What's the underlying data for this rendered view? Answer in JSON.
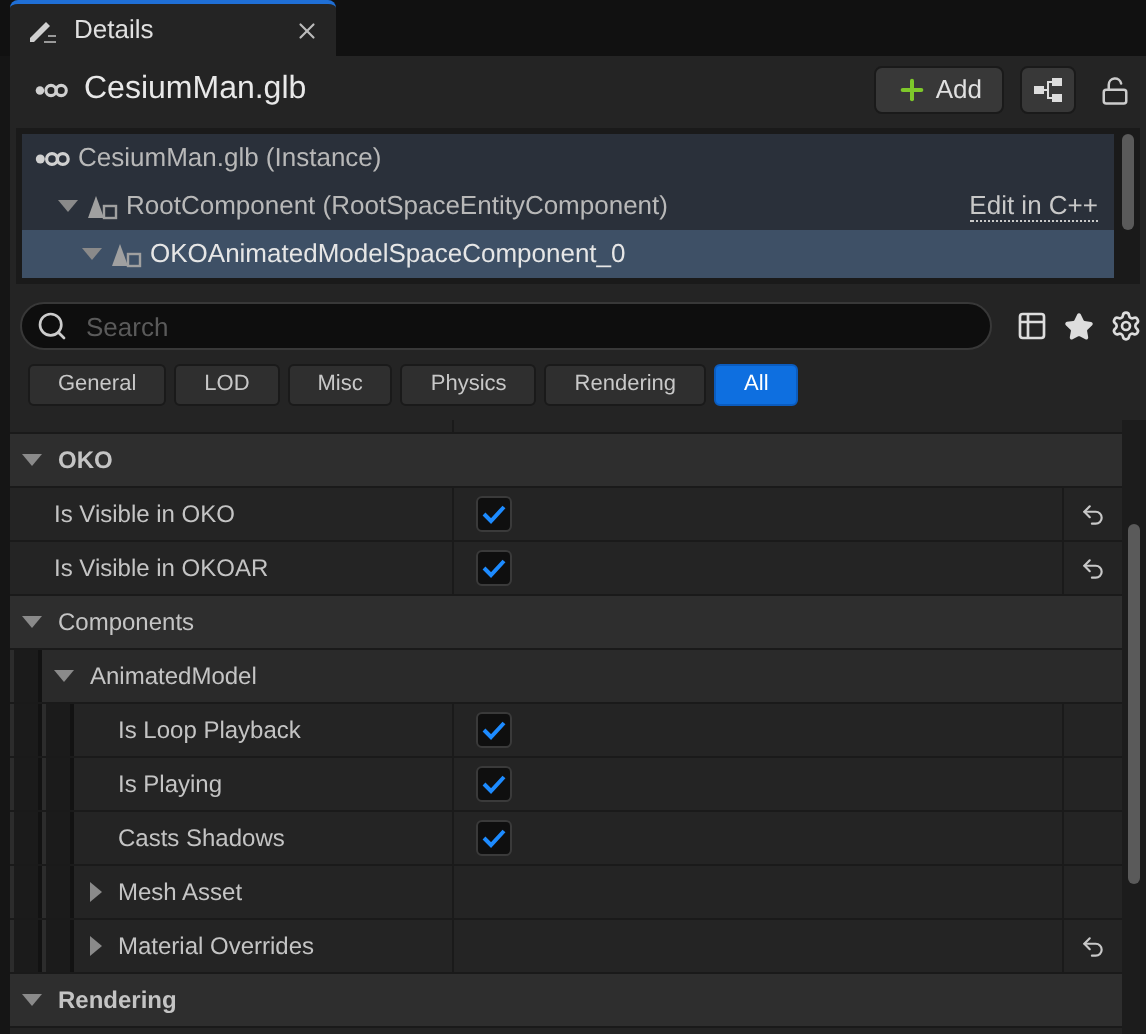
{
  "tab": {
    "title": "Details"
  },
  "header": {
    "title": "CesiumMan.glb",
    "add_button": "Add"
  },
  "tree": {
    "items": [
      {
        "label": "CesiumMan.glb (Instance)",
        "kind": "actor",
        "selected": false,
        "children": [
          {
            "label": "RootComponent (RootSpaceEntityComponent)",
            "kind": "component",
            "expanded": true,
            "selected": false,
            "link": "Edit in C++",
            "children": [
              {
                "label": "OKOAnimatedModelSpaceComponent_0",
                "kind": "component",
                "expanded": true,
                "selected": true
              }
            ]
          }
        ]
      }
    ]
  },
  "search": {
    "placeholder": "Search"
  },
  "filters": [
    {
      "label": "General",
      "selected": false
    },
    {
      "label": "LOD",
      "selected": false
    },
    {
      "label": "Misc",
      "selected": false
    },
    {
      "label": "Physics",
      "selected": false
    },
    {
      "label": "Rendering",
      "selected": false
    },
    {
      "label": "All",
      "selected": true
    }
  ],
  "properties": [
    {
      "kind": "category",
      "label": "OKO",
      "bold": true,
      "expanded": true,
      "children": [
        {
          "kind": "checkbox",
          "label": "Is Visible in OKO",
          "checked": true,
          "resettable": true
        },
        {
          "kind": "checkbox",
          "label": "Is Visible in OKOAR",
          "checked": true,
          "resettable": true
        }
      ]
    },
    {
      "kind": "category",
      "label": "Components",
      "bold": false,
      "expanded": true,
      "children": [
        {
          "kind": "group",
          "label": "AnimatedModel",
          "expanded": true,
          "children": [
            {
              "kind": "checkbox",
              "label": "Is Loop Playback",
              "checked": true,
              "resettable": false
            },
            {
              "kind": "checkbox",
              "label": "Is Playing",
              "checked": true,
              "resettable": false
            },
            {
              "kind": "checkbox",
              "label": "Casts Shadows",
              "checked": true,
              "resettable": false
            },
            {
              "kind": "struct",
              "label": "Mesh Asset",
              "expanded": false,
              "resettable": false
            },
            {
              "kind": "struct",
              "label": "Material Overrides",
              "expanded": false,
              "resettable": true
            }
          ]
        }
      ]
    },
    {
      "kind": "category",
      "label": "Rendering",
      "bold": true,
      "expanded": true
    }
  ]
}
